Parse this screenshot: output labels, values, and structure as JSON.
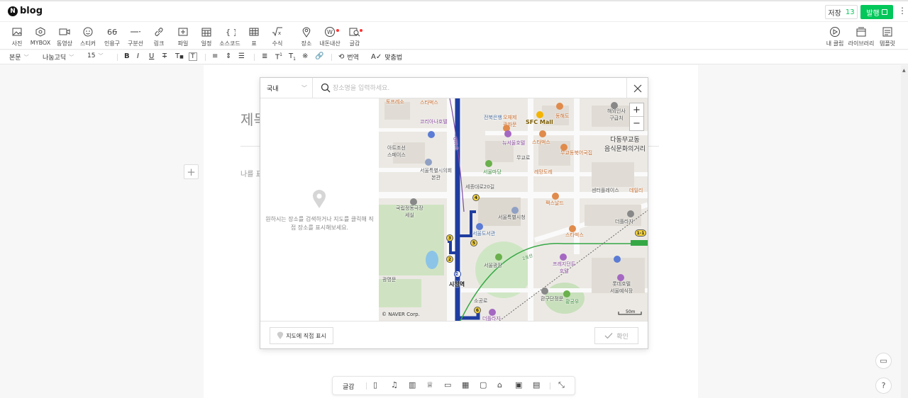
{
  "app": {
    "logo": "blog"
  },
  "topbar": {
    "save_label": "저장",
    "save_count": "13",
    "publish_label": "발행"
  },
  "toolbar": {
    "items": [
      {
        "label": "사진",
        "icon": "photo-icon"
      },
      {
        "label": "MYBOX",
        "icon": "mybox-icon"
      },
      {
        "label": "동영상",
        "icon": "video-icon"
      },
      {
        "label": "스티커",
        "icon": "sticker-icon"
      },
      {
        "label": "인용구",
        "icon": "quote-icon"
      },
      {
        "label": "구분선",
        "icon": "divider-icon"
      },
      {
        "label": "링크",
        "icon": "link-icon"
      },
      {
        "label": "파일",
        "icon": "file-icon"
      },
      {
        "label": "일정",
        "icon": "calendar-icon"
      },
      {
        "label": "소스코드",
        "icon": "code-icon"
      },
      {
        "label": "표",
        "icon": "table-icon"
      },
      {
        "label": "수식",
        "icon": "formula-icon"
      },
      {
        "label": "장소",
        "icon": "place-icon"
      },
      {
        "label": "내돈내산",
        "icon": "won-icon"
      },
      {
        "label": "글감",
        "icon": "material-icon"
      }
    ],
    "right_items": [
      {
        "label": "내 클립",
        "icon": "clip-icon"
      },
      {
        "label": "라이브러리",
        "icon": "library-icon"
      },
      {
        "label": "템플릿",
        "icon": "template-icon"
      }
    ]
  },
  "format": {
    "style": "본문",
    "font": "나눔고딕",
    "size": "15",
    "translate_label": "번역",
    "spellcheck_label": "맞춤법"
  },
  "editor": {
    "title_placeholder": "제목",
    "body_placeholder": "나를 표"
  },
  "modal": {
    "region": "국내",
    "search_placeholder": "장소명을 입력하세요.",
    "side_message": "원하시는 장소를 검색하거나 지도를 클릭해 직접 장소를 표시해보세요.",
    "direct_button": "지도에 직접 표시",
    "confirm_button": "확인"
  },
  "map": {
    "labels": {
      "토프레소": "토프레소",
      "스타벅스1": "스타벅스",
      "코리아나호텔": "코리아나호텔",
      "아트조선": "아트조선\n스페이스",
      "전북은행": "전북은행",
      "오재제": "오재제\n광화문",
      "SFCMall": "SFC Mall",
      "동해도": "동해도",
      "해외인사": "해외인사\n구급처",
      "뉴서울호텔": "뉴서울호텔",
      "스타벅스2": "스타벅스",
      "다동무교동": "다동무교동\n음식문화의거리",
      "무교로": "무교로",
      "무교동북어국집": "무교동북어국집",
      "서울시의회": "서울특별시의회\n본관",
      "서울마당": "서울마당",
      "레망도레": "레망도레",
      "세종대로20길": "세종대로20길",
      "센터플레이스": "센터플레이스",
      "데일리": "데일리",
      "국립정동극장": "국립정동극장\n세실",
      "팩스날드": "팩스날드",
      "서울특별시청": "서울특별시청",
      "더플라자": "더플라자",
      "서울도서관": "서울도서관",
      "스타벅스3": "스타벅스",
      "서울광장": "서울광장",
      "프레지던트호텔": "프레지던트\n호텔",
      "광명문": "광명문",
      "시청역": "시청역",
      "롯데호텔": "롯데호텔\n서울예식장",
      "환구단정문": "환구단정문",
      "황궁우": "황궁우",
      "소공로": "소공로",
      "더플라자2": "더플라자",
      "roadA": "GTX-A",
      "road2": "2호선",
      "road1": "1호선",
      "copyright": "© NAVER Corp.",
      "scale": "50m",
      "exit1_1": "1-1"
    },
    "exits": [
      "1",
      "2",
      "3",
      "4",
      "5",
      "6"
    ]
  },
  "bottombar": {
    "label": "글감"
  },
  "colors": {
    "brand_green": "#03c75a",
    "line1": "#1f3da0",
    "line2": "#35a845"
  }
}
